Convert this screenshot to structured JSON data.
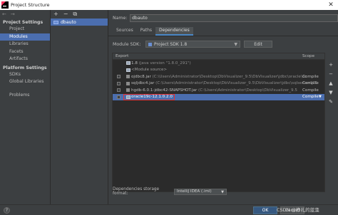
{
  "window": {
    "title": "Project Structure",
    "close_glyph": "✕"
  },
  "nav": {
    "toolbar": [
      "←",
      "→"
    ],
    "sections": [
      {
        "header": "Project Settings",
        "items": [
          "Project",
          "Modules",
          "Libraries",
          "Facets",
          "Artifacts"
        ]
      },
      {
        "header": "Platform Settings",
        "items": [
          "SDKs",
          "Global Libraries"
        ]
      }
    ],
    "problems": "Problems",
    "selected": "Modules"
  },
  "modules": {
    "toolbar": [
      "+",
      "−",
      "⧉"
    ],
    "items": [
      "dbauto"
    ]
  },
  "main": {
    "name_label": "Name:",
    "name_value": "dbauto",
    "tabs": [
      "Sources",
      "Paths",
      "Dependencies"
    ],
    "active_tab": "Dependencies",
    "sdk_label": "Module SDK:",
    "sdk_value": "Project SDK 1.8",
    "edit_label": "Edit",
    "table": {
      "col_export": "Export",
      "col_scope": "Scope",
      "rows": [
        {
          "kind": "jdk",
          "text": "1.8",
          "path": "(java version \"1.8.0_291\")",
          "scope": "",
          "checkbox": false
        },
        {
          "kind": "src",
          "text": "<Module source>",
          "path": "",
          "scope": "",
          "checkbox": false
        },
        {
          "kind": "jar",
          "text": "ojdbc8.jar",
          "path": "(C:\\Users\\Administrator\\Desktop\\DbVisualizer_9.5\\DbVisualizer\\jdbc\\oracle\\oc",
          "scope": "Compile",
          "checkbox": true
        },
        {
          "kind": "jar",
          "text": "sqljdbc4.jar",
          "path": "(C:\\Users\\Administrator\\Desktop\\DbVisualizer_9.5\\DbVisualizer\\jdbc\\sqlserver201",
          "scope": "Compile",
          "checkbox": true
        },
        {
          "kind": "jar",
          "text": "hgdb-6.0.1-jdbc42-SNAPSHOT.jar",
          "path": "(C:\\Users\\Administrator\\Desktop\\DbVisualizer_9.5",
          "scope": "Compile",
          "checkbox": true
        },
        {
          "kind": "lib",
          "text": "oracle19c-12.1.0.2.0",
          "path": "",
          "scope": "Compile",
          "checkbox": true,
          "selected": true,
          "highlighted": true
        }
      ]
    },
    "side_tools": [
      "+",
      "−",
      "▲",
      "▼",
      "✎"
    ],
    "storage_label": "Dependencies storage format:",
    "storage_value": "IntelliJ IDEA (.iml)"
  },
  "footer": {
    "help": "?",
    "ok": "OK",
    "cancel": "Cancel"
  },
  "watermark": "CSDN @挣扎的蓝藻",
  "colors": {
    "selection": "#4b6eaf",
    "highlight_box": "#e83131",
    "background": "#3c3f41"
  }
}
